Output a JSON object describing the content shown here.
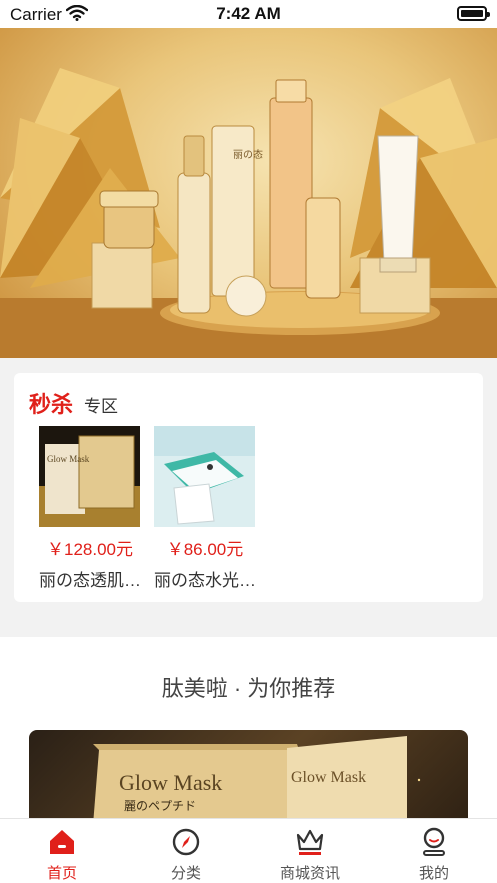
{
  "status_bar": {
    "carrier": "Carrier",
    "time": "7:42 AM"
  },
  "flash_sale": {
    "title": "秒杀",
    "subtitle": "专区",
    "products": [
      {
        "price": "￥128.00元",
        "name": "丽の态透肌…",
        "image_text": "Glow Mask"
      },
      {
        "price": "￥86.00元",
        "name": "丽の态水光…"
      }
    ]
  },
  "recommend": {
    "title": "肽美啦 · 为你推荐",
    "banner_text": "Glow Mask",
    "banner_sub": "麗のペプチド"
  },
  "banner": {
    "brand_text": "丽の态"
  },
  "tabbar": {
    "items": [
      {
        "label": "首页",
        "icon": "home-icon",
        "active": true
      },
      {
        "label": "分类",
        "icon": "compass-icon",
        "active": false
      },
      {
        "label": "商城资讯",
        "icon": "crown-icon",
        "active": false
      },
      {
        "label": "我的",
        "icon": "user-icon",
        "active": false
      }
    ]
  },
  "colors": {
    "accent": "#e0201a",
    "gold": "#d9a94b"
  }
}
